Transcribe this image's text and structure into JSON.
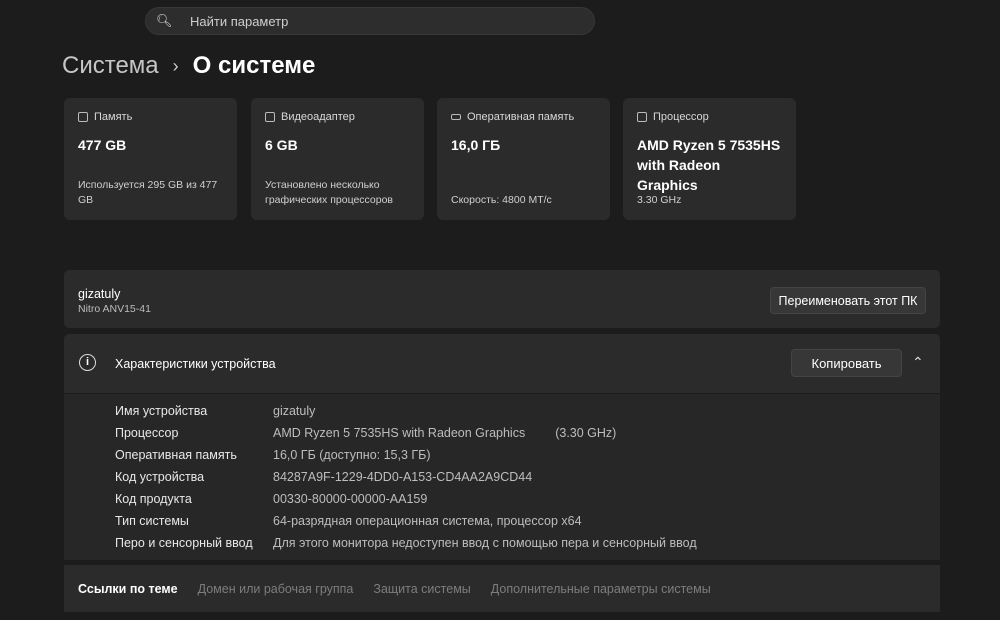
{
  "search": {
    "placeholder": "Найти параметр"
  },
  "breadcrumb": {
    "parent": "Система",
    "chevron": "›",
    "current": "О системе"
  },
  "cards": [
    {
      "label": "Память",
      "value": "477 GB",
      "sub": "Используется 295 GB из 477 GB",
      "icon": "storage-icon"
    },
    {
      "label": "Видеоадаптер",
      "value": "6 GB",
      "sub": "Установлено несколько графических процессоров",
      "icon": "gpu-icon"
    },
    {
      "label": "Оперативная память",
      "value": "16,0 ГБ",
      "sub": "Скорость: 4800 МТ/с",
      "icon": "ram-icon"
    },
    {
      "label": "Процессор",
      "value": "AMD Ryzen 5 7535HS with Radeon Graphics",
      "sub": "3.30 GHz",
      "icon": "cpu-icon"
    }
  ],
  "pc": {
    "name": "gizatuly",
    "model": "Nitro ANV15-41",
    "rename_label": "Переименовать этот ПК"
  },
  "specs": {
    "title": "Характеристики устройства",
    "copy_label": "Копировать",
    "rows": [
      {
        "k": "Имя устройства",
        "v": "gizatuly"
      },
      {
        "k": "Процессор",
        "v": "AMD Ryzen 5 7535HS with Radeon Graphics",
        "v2": "(3.30 GHz)"
      },
      {
        "k": "Оперативная память",
        "v": "16,0 ГБ (доступно: 15,3 ГБ)"
      },
      {
        "k": "Код устройства",
        "v": "84287A9F-1229-4DD0-A153-CD4AA2A9CD44"
      },
      {
        "k": "Код продукта",
        "v": "00330-80000-00000-AA159"
      },
      {
        "k": "Тип системы",
        "v": "64-разрядная операционная система, процессор x64"
      },
      {
        "k": "Перо и сенсорный ввод",
        "v": "Для этого монитора недоступен ввод с помощью пера и сенсорный ввод"
      }
    ]
  },
  "links": {
    "title": "Ссылки по теме",
    "items": [
      "Домен или рабочая группа",
      "Защита системы",
      "Дополнительные параметры системы"
    ]
  }
}
